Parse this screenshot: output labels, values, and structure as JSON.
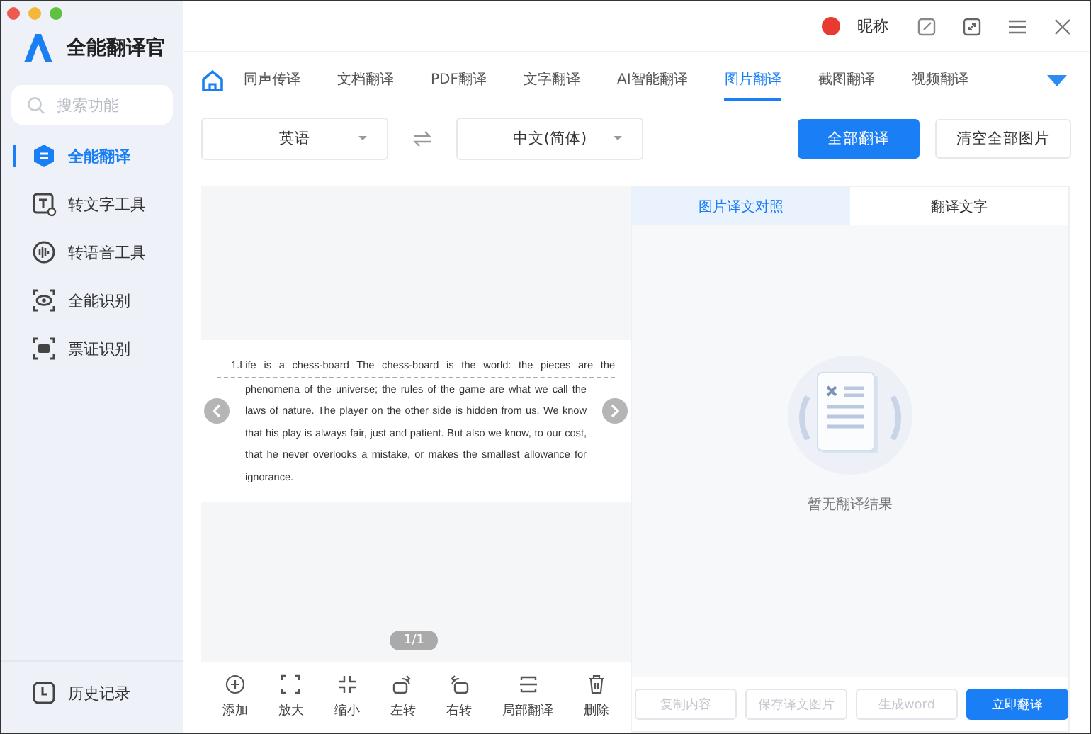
{
  "app": {
    "title": "全能翻译官"
  },
  "search": {
    "placeholder": "搜索功能"
  },
  "sidebar": {
    "items": [
      {
        "label": "全能翻译",
        "selected": true
      },
      {
        "label": "转文字工具",
        "selected": false
      },
      {
        "label": "转语音工具",
        "selected": false
      },
      {
        "label": "全能识别",
        "selected": false
      },
      {
        "label": "票证识别",
        "selected": false
      }
    ],
    "footer": "历史记录"
  },
  "user": {
    "name": "昵称"
  },
  "tabs": [
    {
      "label": "同声传译",
      "selected": false
    },
    {
      "label": "文档翻译",
      "selected": false
    },
    {
      "label": "PDF翻译",
      "selected": false
    },
    {
      "label": "文字翻译",
      "selected": false
    },
    {
      "label": "AI智能翻译",
      "selected": false
    },
    {
      "label": "图片翻译",
      "selected": true
    },
    {
      "label": "截图翻译",
      "selected": false
    },
    {
      "label": "视频翻译",
      "selected": false
    }
  ],
  "source_language": "英语",
  "target_language": "中文(简体)",
  "actions": [
    {
      "label": "全部翻译",
      "primary": true
    },
    {
      "label": "清空全部图片",
      "primary": false
    }
  ],
  "image": {
    "first_line": "1.Life is a chess-board The chess-board is the world: the pieces are the",
    "text": "phenomena of the universe; the rules of the game are what we call the laws of nature. The player on the other side is hidden from us. We know that his play is always fair, just and patient. But also we know, to our cost, that he never overlooks a mistake, or makes the smallest allowance for ignorance.",
    "page": "1/1"
  },
  "toolbar": [
    "添加",
    "放大",
    "缩小",
    "左转",
    "右转",
    "局部翻译",
    "删除"
  ],
  "result_tabs": [
    {
      "label": "图片译文对照",
      "selected": true
    },
    {
      "label": "翻译文字",
      "selected": false
    }
  ],
  "empty_message": "暂无翻译结果",
  "bottom_buttons": [
    {
      "label": "复制内容",
      "disabled": true,
      "primary": false
    },
    {
      "label": "保存译文图片",
      "disabled": true,
      "primary": false
    },
    {
      "label": "生成word",
      "disabled": true,
      "primary": false
    },
    {
      "label": "立即翻译",
      "disabled": false,
      "primary": true
    }
  ]
}
